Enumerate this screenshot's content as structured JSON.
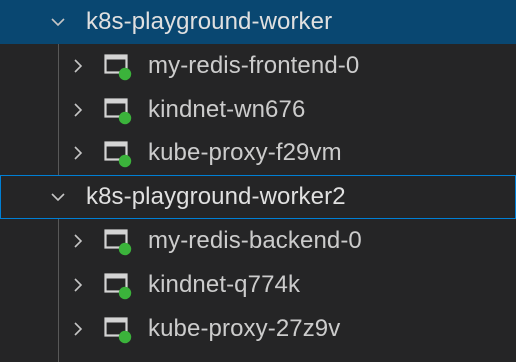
{
  "tree": {
    "nodes": [
      {
        "label": "k8s-playground-worker",
        "state": "expanded",
        "selected": true,
        "pods": [
          {
            "label": "my-redis-frontend-0",
            "status": "running"
          },
          {
            "label": "kindnet-wn676",
            "status": "running"
          },
          {
            "label": "kube-proxy-f29vm",
            "status": "running"
          }
        ]
      },
      {
        "label": "k8s-playground-worker2",
        "state": "expanded",
        "focused": true,
        "pods": [
          {
            "label": "my-redis-backend-0",
            "status": "running"
          },
          {
            "label": "kindnet-q774k",
            "status": "running"
          },
          {
            "label": "kube-proxy-27z9v",
            "status": "running"
          }
        ]
      }
    ],
    "colors": {
      "background": "#252526",
      "selection": "#094771",
      "focus_border": "#007fd4",
      "status_running": "#3bb33b",
      "text": "#cccccc"
    },
    "icons": {
      "expanded": "chevron-down-icon",
      "collapsed": "chevron-right-icon",
      "pod": "pod-icon"
    }
  }
}
